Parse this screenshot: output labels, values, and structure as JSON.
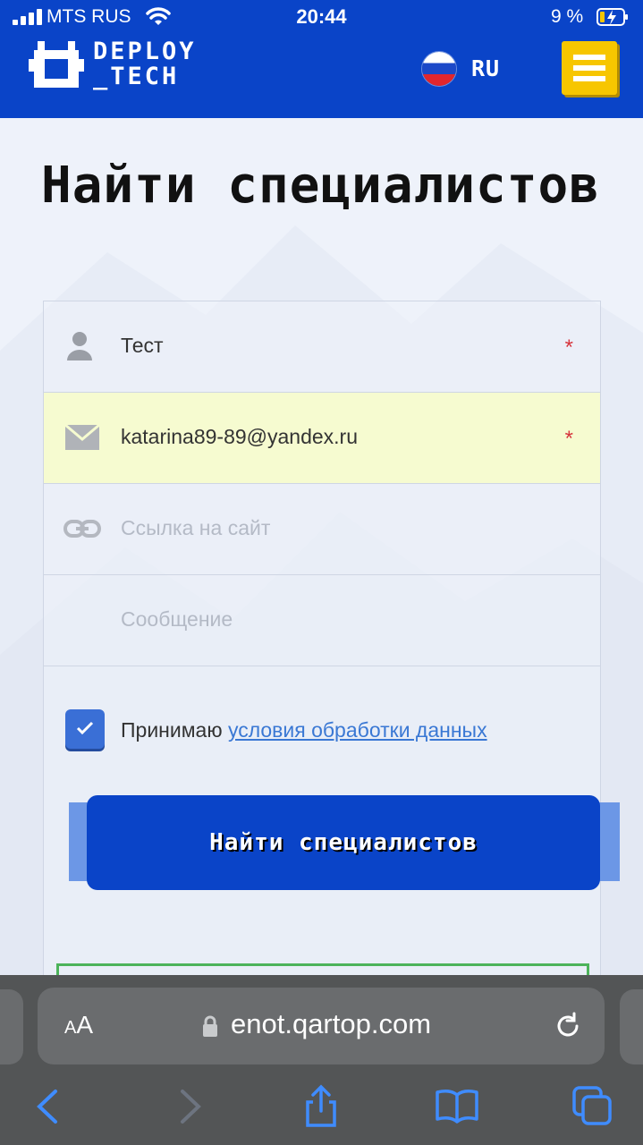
{
  "status_bar": {
    "carrier": "MTS RUS",
    "time": "20:44",
    "battery_percent": "9 %"
  },
  "header": {
    "logo_text_line1": "DEPLOY",
    "logo_text_line2": "_TECH",
    "language": "RU",
    "menu_icon": "hamburger-menu-icon"
  },
  "page": {
    "title": "Найти специалистов"
  },
  "form": {
    "name": {
      "value": "Тест",
      "required_mark": "*",
      "icon": "user-icon"
    },
    "email": {
      "value": "katarina89-89@yandex.ru",
      "required_mark": "*",
      "icon": "mail-icon"
    },
    "website": {
      "placeholder": "Ссылка на сайт",
      "icon": "link-icon"
    },
    "message": {
      "placeholder": "Сообщение"
    },
    "consent": {
      "checked": true,
      "text": "Принимаю",
      "link_text": "условия обработки данных"
    },
    "submit_label": "Найти специалистов"
  },
  "browser": {
    "aa_label_small": "A",
    "aa_label_large": "A",
    "url": "enot.qartop.com"
  },
  "colors": {
    "brand_blue": "#0a44c8",
    "menu_yellow": "#f7c600",
    "required_red": "#d6343c",
    "link_blue": "#3a78d4",
    "email_highlight": "#f6fbd0"
  }
}
